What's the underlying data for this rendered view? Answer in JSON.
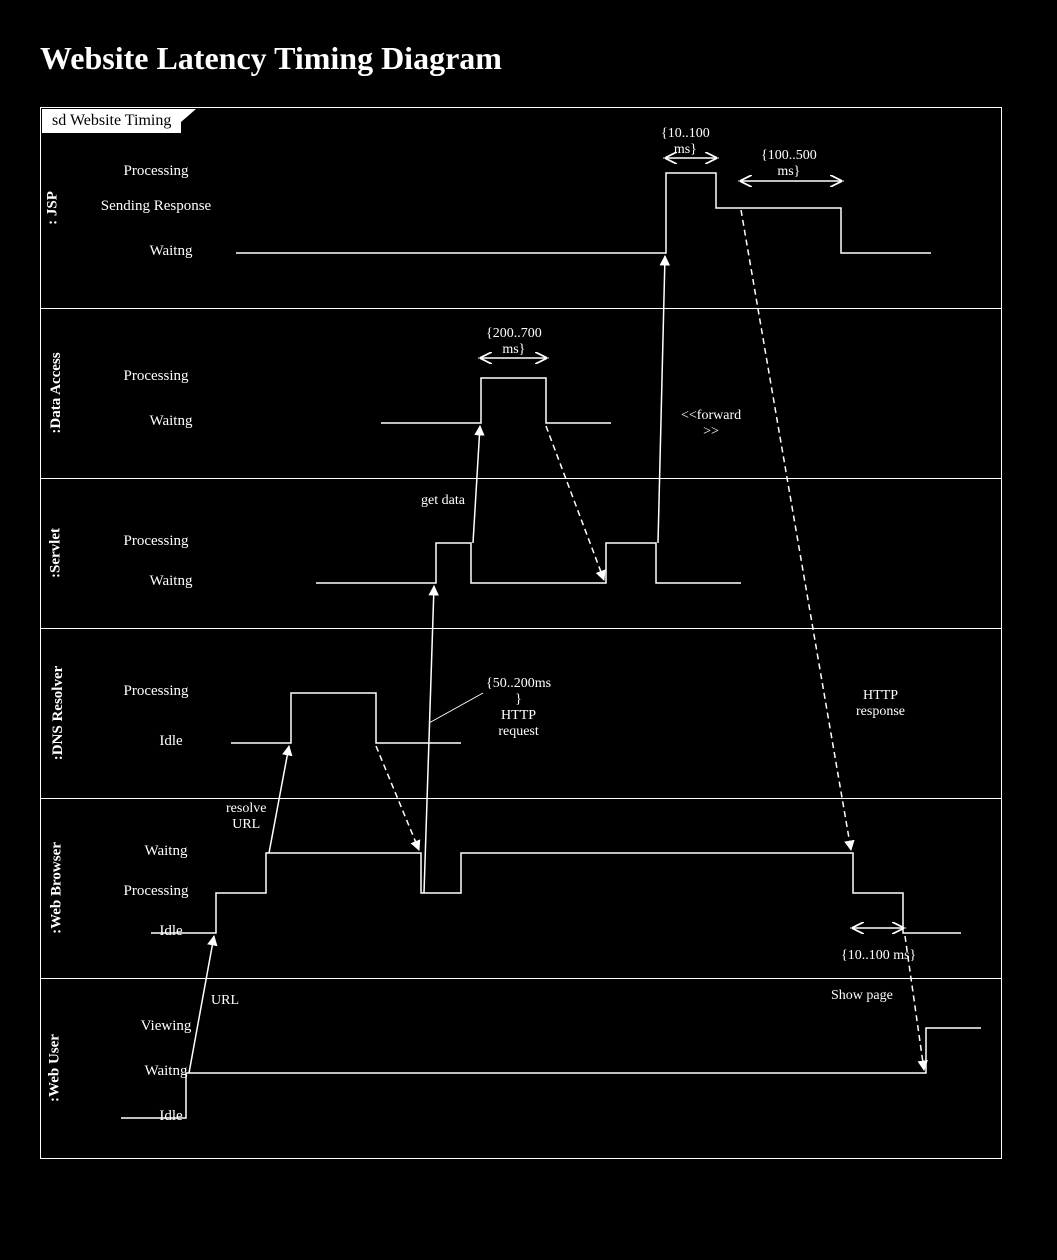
{
  "title": "Website Latency Timing Diagram",
  "frame_label": "sd Website Timing",
  "lanes": {
    "jsp": {
      "name": ": JSP",
      "states": [
        "Processing",
        "Sending Response",
        "Waitng"
      ]
    },
    "data_access": {
      "name": ":Data Access",
      "states": [
        "Processing",
        "Waitng"
      ]
    },
    "servlet": {
      "name": ":Servlet",
      "states": [
        "Processing",
        "Waitng"
      ]
    },
    "dns_resolver": {
      "name": ":DNS Resolver",
      "states": [
        "Processing",
        "Idle"
      ]
    },
    "web_browser": {
      "name": ":Web Browser",
      "states": [
        "Waitng",
        "Processing",
        "Idle"
      ]
    },
    "web_user": {
      "name": ":Web User",
      "states": [
        "Viewing",
        "Waitng",
        "Idle"
      ]
    }
  },
  "annotations": {
    "jsp_proc_time": "{10..100\nms}",
    "jsp_send_time": "{100..500\nms}",
    "da_proc_time": "{200..700\nms}",
    "forward": "<<forward\n>>",
    "get_data": "get data",
    "http_req_time": "{50..200ms\n}\nHTTP\nrequest",
    "http_response": "HTTP\nresponse",
    "resolve_url": "resolve\nURL",
    "browser_proc_time": "{10..100 ms}",
    "url": "URL",
    "show_page": "Show page"
  }
}
